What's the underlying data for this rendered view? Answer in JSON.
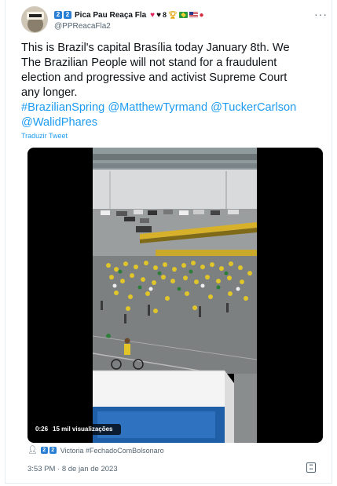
{
  "author": {
    "name": "Pica Pau Reaça Fla",
    "name_prefix_boxes": [
      "2",
      "2"
    ],
    "name_suffix_eight": "8",
    "handle": "@PPReacaFla2"
  },
  "tweet": {
    "line1": "This is Brazil's capital Brasília today January 8th. We",
    "line2": "The Brazilian People will not stand for a fraudulent",
    "line3": "election and progressive and activist Supreme Court",
    "line4": "any longer.",
    "hashtags_line1": "#BrazilianSpring @MatthewTyrmand @TuckerCarlson",
    "hashtags_line2": "@WalidPhares"
  },
  "translate_label": "Traduzir Tweet",
  "video": {
    "duration": "0:26",
    "views": "15 mil visualizações"
  },
  "reply_row": {
    "boxes": [
      "2",
      "2"
    ],
    "text": "Victoria #FechadoComBolsonaro"
  },
  "timestamp": "3:53 PM · 8 de jan de 2023",
  "icons": {
    "more": "more-options-icon",
    "person": "person-icon",
    "gif": "gif-icon"
  },
  "colors": {
    "link": "#1d9bf0",
    "muted": "#536471",
    "text": "#0f1419",
    "emoji_box": "#2a7fd4"
  }
}
